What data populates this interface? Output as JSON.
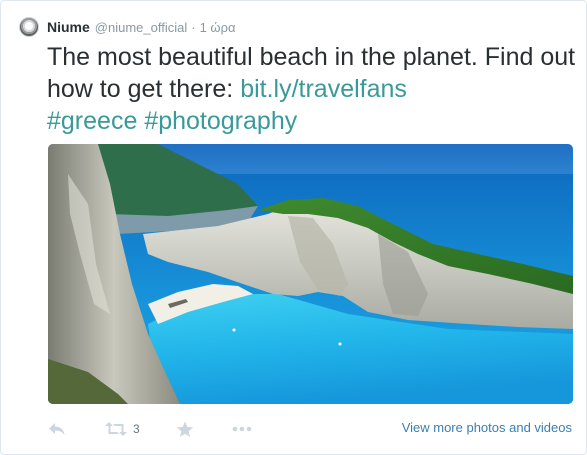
{
  "tweet": {
    "author_name": "Niume",
    "author_handle": "@niume_official",
    "separator": "·",
    "timestamp": "1 ώρα",
    "text_part1": "The most beautiful beach in the planet. Find out how to get there: ",
    "link": "bit.ly/travelfans",
    "hashtag1": "#greece",
    "hashtag2": "#photography"
  },
  "actions": {
    "retweet_count": "3",
    "view_more_label": "View more photos and videos"
  },
  "colors": {
    "link": "#3a9a98",
    "meta_gray": "#8899a6",
    "icon_gray": "#ccd6dd"
  },
  "icons": [
    "reply-icon",
    "retweet-icon",
    "favorite-icon",
    "more-icon"
  ]
}
